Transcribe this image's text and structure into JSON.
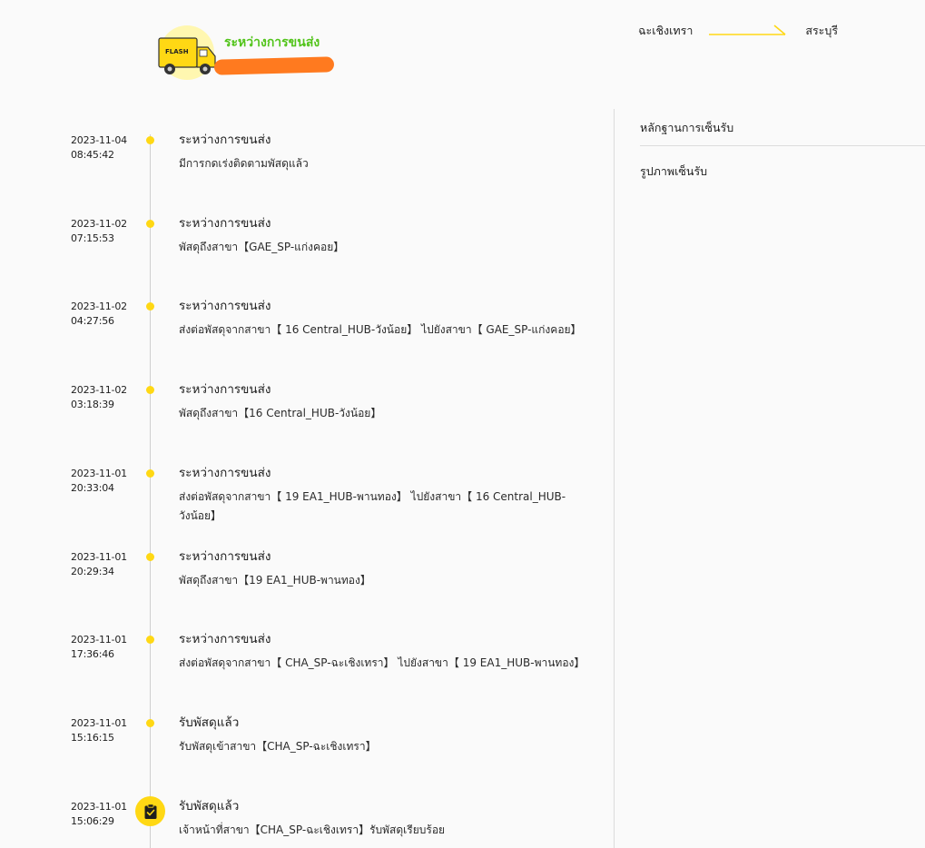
{
  "header": {
    "status_title": "ระหว่างการขนส่ง",
    "truck_logo_text": "FLASH",
    "route": {
      "origin": "ฉะเชิงเทรา",
      "destination": "สระบุรี"
    }
  },
  "side_panel": {
    "proof_of_delivery": "หลักฐานการเซ็นรับ",
    "signature_photo": "รูปภาพเซ็นรับ"
  },
  "colors": {
    "accent_yellow": "#ffd814",
    "status_green": "#52c41a",
    "redaction_orange": "#ff7a1f"
  },
  "events": [
    {
      "date": "2023-11-04",
      "time": "08:45:42",
      "title": "ระหว่างการขนส่ง",
      "desc": "มีการกดเร่งติดตามพัสดุแล้ว"
    },
    {
      "date": "2023-11-02",
      "time": "07:15:53",
      "title": "ระหว่างการขนส่ง",
      "desc": "พัสดุถึงสาขา【GAE_SP-แก่งคอย】"
    },
    {
      "date": "2023-11-02",
      "time": "04:27:56",
      "title": "ระหว่างการขนส่ง",
      "desc": "ส่งต่อพัสดุจากสาขา【 16 Central_HUB-วังน้อย】 ไปยังสาขา【 GAE_SP-แก่งคอย】"
    },
    {
      "date": "2023-11-02",
      "time": "03:18:39",
      "title": "ระหว่างการขนส่ง",
      "desc": "พัสดุถึงสาขา【16 Central_HUB-วังน้อย】"
    },
    {
      "date": "2023-11-01",
      "time": "20:33:04",
      "title": "ระหว่างการขนส่ง",
      "desc": "ส่งต่อพัสดุจากสาขา【 19 EA1_HUB-พานทอง】 ไปยังสาขา【 16 Central_HUB-วังน้อย】"
    },
    {
      "date": "2023-11-01",
      "time": "20:29:34",
      "title": "ระหว่างการขนส่ง",
      "desc": "พัสดุถึงสาขา【19 EA1_HUB-พานทอง】"
    },
    {
      "date": "2023-11-01",
      "time": "17:36:46",
      "title": "ระหว่างการขนส่ง",
      "desc": "ส่งต่อพัสดุจากสาขา【 CHA_SP-ฉะเชิงเทรา】 ไปยังสาขา【 19 EA1_HUB-พานทอง】"
    },
    {
      "date": "2023-11-01",
      "time": "15:16:15",
      "title": "รับพัสดุแล้ว",
      "desc": "รับพัสดุเข้าสาขา【CHA_SP-ฉะเชิงเทรา】"
    },
    {
      "date": "2023-11-01",
      "time": "15:06:29",
      "title": "รับพัสดุแล้ว",
      "desc": "เจ้าหน้าที่สาขา【CHA_SP-ฉะเชิงเทรา】รับพัสดุเรียบร้อย"
    }
  ]
}
